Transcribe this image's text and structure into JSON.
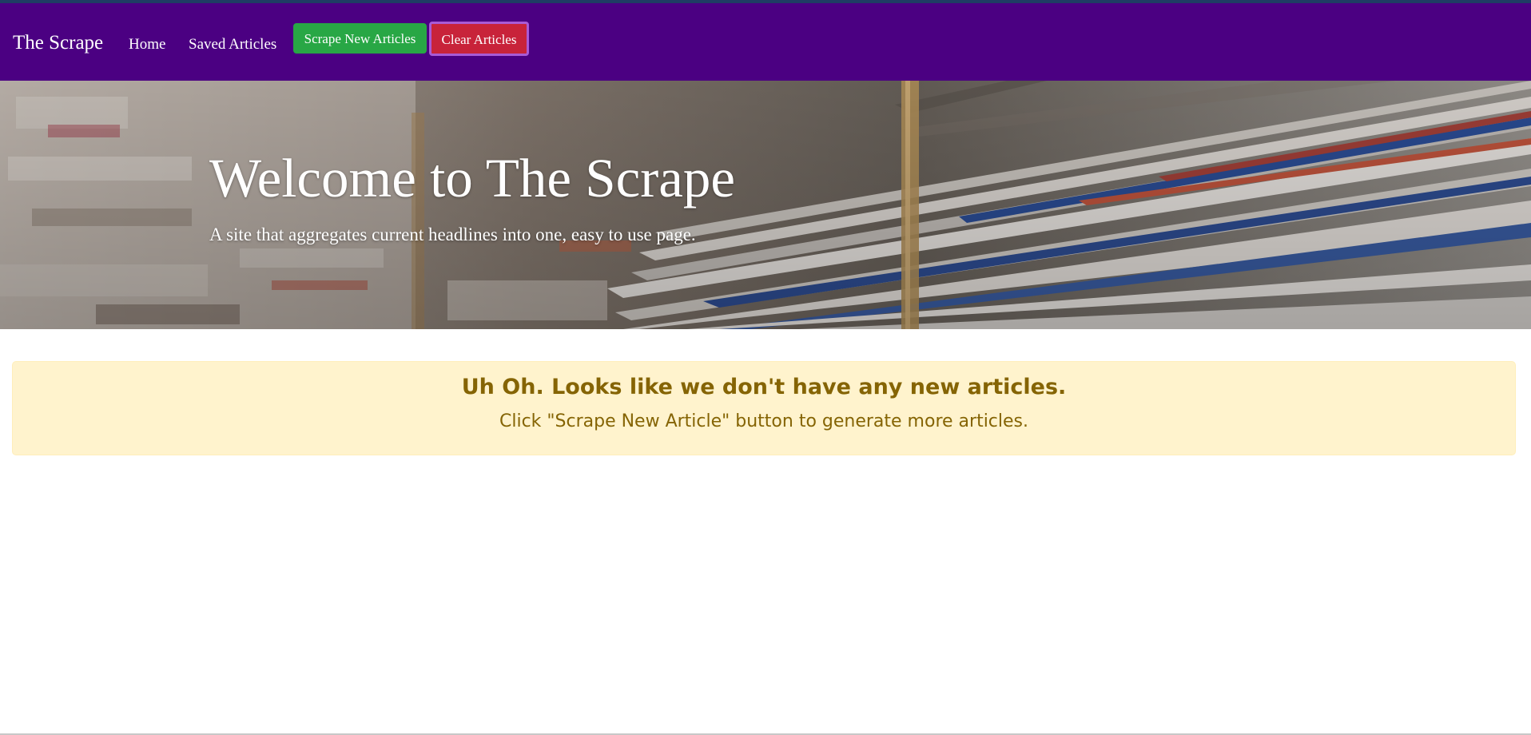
{
  "navbar": {
    "brand": "The Scrape",
    "links": [
      {
        "label": "Home"
      },
      {
        "label": "Saved Articles"
      }
    ],
    "scrape_button": "Scrape New Articles",
    "clear_button": "Clear Articles"
  },
  "hero": {
    "title": "Welcome to The Scrape",
    "subtitle": "A site that aggregates current headlines into one, easy to use page."
  },
  "alert": {
    "heading": "Uh Oh. Looks like we don't have any new articles.",
    "body": "Click \"Scrape New Article\" button to generate more articles."
  },
  "colors": {
    "navbar": "#4b0082",
    "scrape_button": "#28a745",
    "clear_button": "#c8233a",
    "alert_background": "#fff3cd",
    "alert_text": "#856404"
  }
}
